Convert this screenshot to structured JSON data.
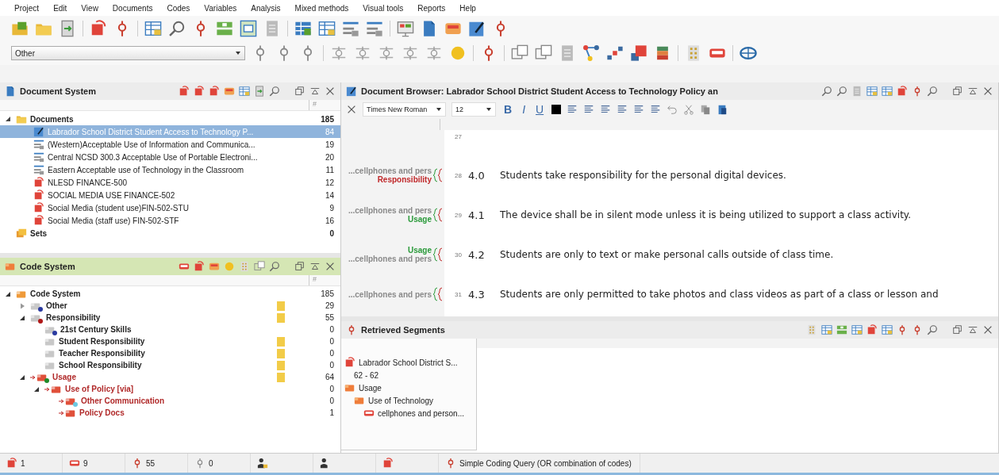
{
  "menu": [
    "Project",
    "Edit",
    "View",
    "Documents",
    "Codes",
    "Variables",
    "Analysis",
    "Mixed methods",
    "Visual tools",
    "Reports",
    "Help"
  ],
  "code_combo": {
    "value": "Other"
  },
  "document_system": {
    "title": "Document System",
    "count_header": "#",
    "tree": [
      {
        "label": "Documents",
        "count": "185",
        "kind": "folder",
        "expanded": true,
        "selected": false,
        "children": [
          {
            "label": "Labrador School District Student Access to Technology P...",
            "count": "84",
            "kind": "coded",
            "selected": true
          },
          {
            "label": "(Western)Acceptable Use of Information and Communica...",
            "count": "19",
            "kind": "text",
            "selected": false
          },
          {
            "label": "Central NCSD 300.3 Acceptable Use of Portable Electroni...",
            "count": "20",
            "kind": "text",
            "selected": false
          },
          {
            "label": "Eastern Acceptable use of Technology in the Classroom",
            "count": "11",
            "kind": "text",
            "selected": false
          },
          {
            "label": "NLESD FINANCE-500",
            "count": "12",
            "kind": "pdf",
            "selected": false
          },
          {
            "label": "SOCIAL MEDIA USE FINANCE-502",
            "count": "14",
            "kind": "pdf",
            "selected": false
          },
          {
            "label": "Social Media (student use)FIN-502-STU",
            "count": "9",
            "kind": "pdf",
            "selected": false
          },
          {
            "label": "Social Media (staff use) FIN-502-STF",
            "count": "16",
            "kind": "pdf",
            "selected": false
          }
        ]
      },
      {
        "label": "Sets",
        "count": "0",
        "kind": "sets",
        "selected": false
      }
    ]
  },
  "code_system": {
    "title": "Code System",
    "count_header": "#",
    "tree": [
      {
        "label": "Code System",
        "count": "185",
        "expanded": true,
        "activated": false,
        "marked": false,
        "children": [
          {
            "label": "Other",
            "count": "29",
            "color": "#2a3aa0",
            "expanded": false,
            "activated": false,
            "marked": true
          },
          {
            "label": "Responsibility",
            "count": "55",
            "color": "#b01818",
            "expanded": true,
            "activated": false,
            "marked": true,
            "children": [
              {
                "label": "21st Century Skills",
                "count": "0",
                "color": "#2a3aa0",
                "activated": false,
                "marked": false
              },
              {
                "label": "Student Responsibility",
                "count": "0",
                "activated": false,
                "marked": true
              },
              {
                "label": "Teacher Responsibility",
                "count": "0",
                "activated": false,
                "marked": true
              },
              {
                "label": "School Responsibility",
                "count": "0",
                "activated": false,
                "marked": true
              }
            ]
          },
          {
            "label": "Usage",
            "count": "64",
            "color": "#1f8a2a",
            "expanded": true,
            "activated": true,
            "marked": true,
            "children": [
              {
                "label": "Use of Policy [via]",
                "count": "0",
                "expanded": true,
                "activated": true,
                "marked": false,
                "children": [
                  {
                    "label": "Other Communication",
                    "count": "0",
                    "color": "#6cc8e0",
                    "activated": true,
                    "marked": false
                  },
                  {
                    "label": "Policy Docs",
                    "count": "1",
                    "activated": true,
                    "marked": false
                  }
                ]
              }
            ]
          }
        ]
      }
    ]
  },
  "document_browser": {
    "title": "Document Browser: Labrador School District Student Access to Technology Policy an",
    "font": "Times New Roman",
    "size": "12",
    "format_buttons": [
      "B",
      "I",
      "U"
    ],
    "lines": [
      {
        "number": "27"
      },
      {
        "number": "28",
        "para": "4.0",
        "text": "Students take responsibility for the personal digital devices.",
        "codes": [
          {
            "label": "...cellphones and pers",
            "color": "#8a8a8a"
          },
          {
            "label": "Responsibility",
            "color": "#c0282a"
          }
        ]
      },
      {
        "number": "29",
        "para": "4.1",
        "text": "The device shall be in silent mode unless it is being utilized to support a class activity.",
        "codes": [
          {
            "label": "...cellphones and pers",
            "color": "#8a8a8a"
          },
          {
            "label": "Usage",
            "color": "#2a9a3a"
          }
        ]
      },
      {
        "number": "30",
        "para": "4.2",
        "text": "Students are only to text or make personal calls outside of class time.",
        "codes": [
          {
            "label": "Usage",
            "color": "#2a9a3a"
          },
          {
            "label": "...cellphones and pers",
            "color": "#8a8a8a"
          }
        ]
      },
      {
        "number": "31",
        "para": "4.3",
        "text": "Students are only permitted to take photos and class videos as part of a class or lesson and",
        "codes": [
          {
            "label": "...cellphones and pers",
            "color": "#8a8a8a"
          }
        ]
      }
    ]
  },
  "retrieved_segments": {
    "title": "Retrieved Segments",
    "tree": [
      {
        "label": "Labrador School District S...",
        "kind": "document",
        "children": [
          {
            "label": "62 - 62",
            "kind": "range"
          }
        ]
      },
      {
        "label": "Usage",
        "kind": "code",
        "children": [
          {
            "label": "Use of Technology",
            "kind": "code",
            "children": [
              {
                "label": "cellphones and person...",
                "kind": "subcode"
              }
            ]
          }
        ]
      }
    ]
  },
  "status_bar": {
    "counts": [
      "1",
      "9",
      "55",
      "0"
    ],
    "query": "Simple Coding Query (OR combination of codes)"
  }
}
